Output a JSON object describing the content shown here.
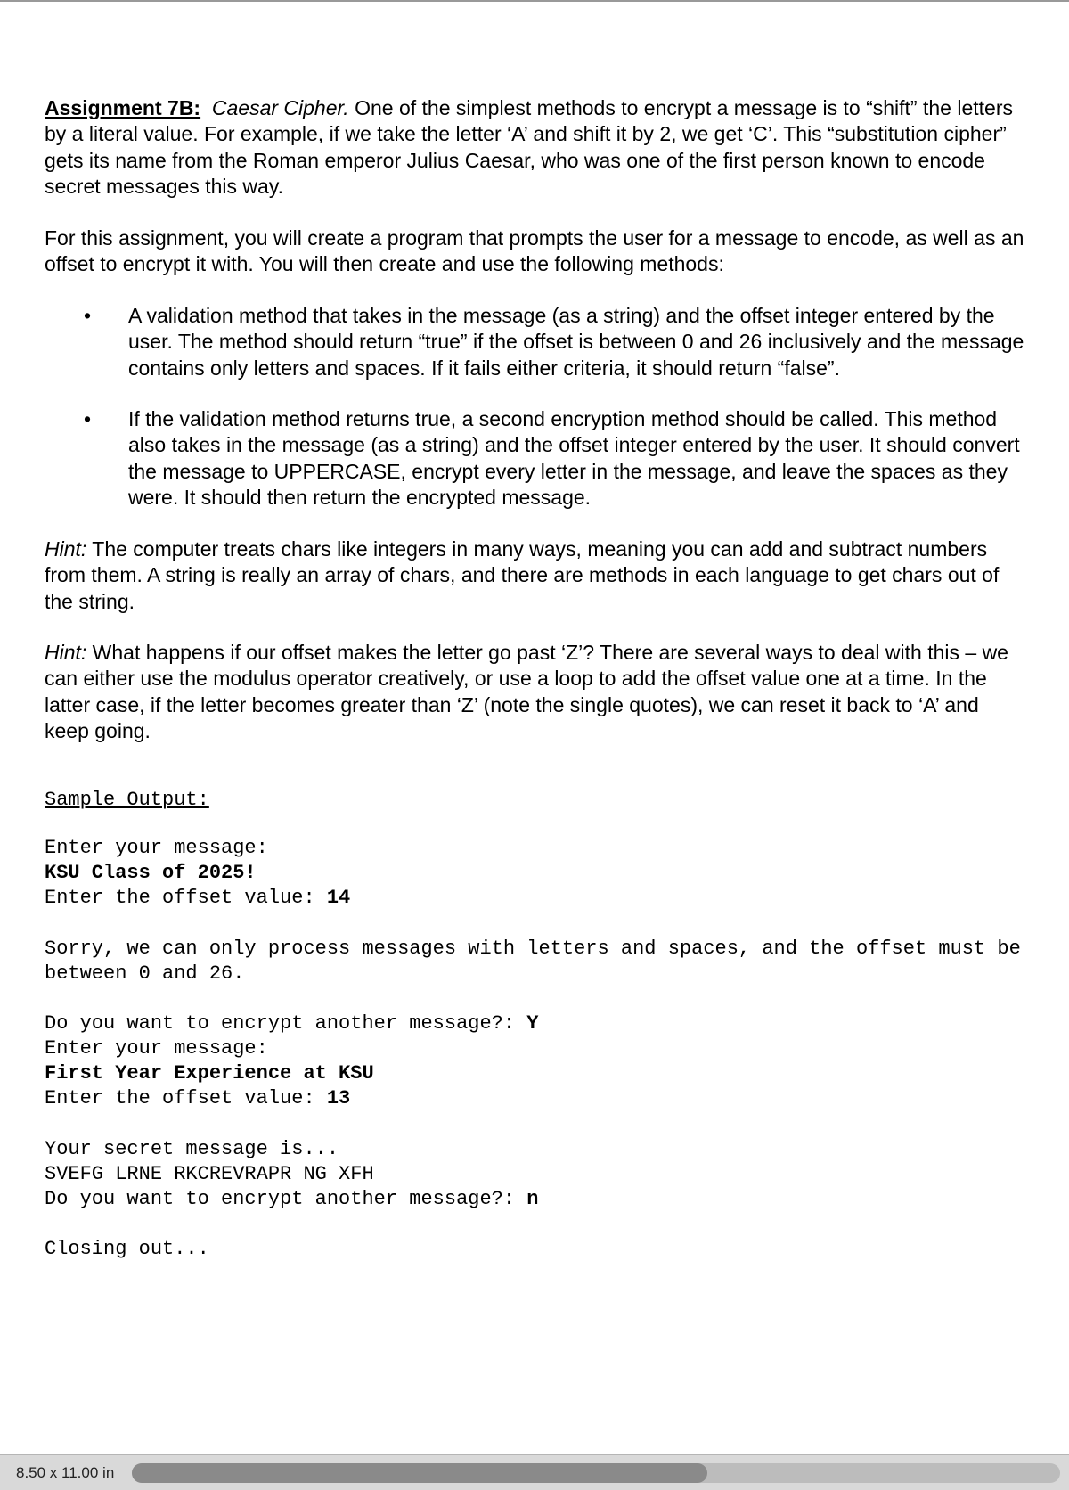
{
  "doc": {
    "title": "Assignment 7B:",
    "subtitle": "Caesar Cipher.",
    "intro_rest": " One of the simplest methods to encrypt a message is to “shift” the letters by a literal value. For example, if we take the letter ‘A’ and shift it by 2, we get ‘C’. This “substitution cipher” gets its name from the Roman emperor Julius Caesar, who was one of the first person known to encode secret messages this way.",
    "para2": "For this assignment, you will create a program that prompts the user for a message to encode, as well as an offset to encrypt it with. You will then create and use the following methods:",
    "bullets": [
      "A validation method that takes in the message (as a string) and the offset integer entered by the user. The method should return “true” if the offset is between 0 and 26 inclusively and the message contains only letters and spaces. If it fails either criteria, it should return “false”.",
      "If the validation method returns true, a second encryption method should be called. This method also takes in the message (as a string) and the offset integer entered by the user. It should convert the message to UPPERCASE, encrypt every letter in the message, and leave the spaces as they were. It should then return the encrypted message."
    ],
    "hint1_label": "Hint:",
    "hint1": " The computer treats chars like integers in many ways, meaning you can add and subtract numbers from them. A string is really an array of chars, and there are methods in each language to get chars out of the string.",
    "hint2_label": "Hint:",
    "hint2": " What happens if our offset makes the letter go past ‘Z’? There are several ways to deal with this – we can either use the modulus operator creatively, or use a loop to add the offset value one at a time. In the latter case, if the letter becomes greater than ‘Z’ (note the single quotes), we can reset it back to ‘A’ and keep going.",
    "sample_label": "Sample Output:",
    "sample": {
      "l1": "Enter your message:",
      "l2": "KSU Class of 2025!",
      "l3a": "Enter the offset value: ",
      "l3b": "14",
      "l4": "Sorry, we can only process messages with letters and spaces, and the offset must be between 0 and 26.",
      "l5a": "Do you want to encrypt another message?: ",
      "l5b": "Y",
      "l6": "Enter your message:",
      "l7": "First Year Experience at KSU",
      "l8a": "Enter the offset value: ",
      "l8b": "13",
      "l9": "Your secret message is...",
      "l10": "SVEFG LRNE RKCREVRAPR NG XFH",
      "l11a": "Do you want to encrypt another message?: ",
      "l11b": "n",
      "l12": "Closing out..."
    }
  },
  "status": {
    "pagesize": "8.50 x 11.00 in"
  }
}
